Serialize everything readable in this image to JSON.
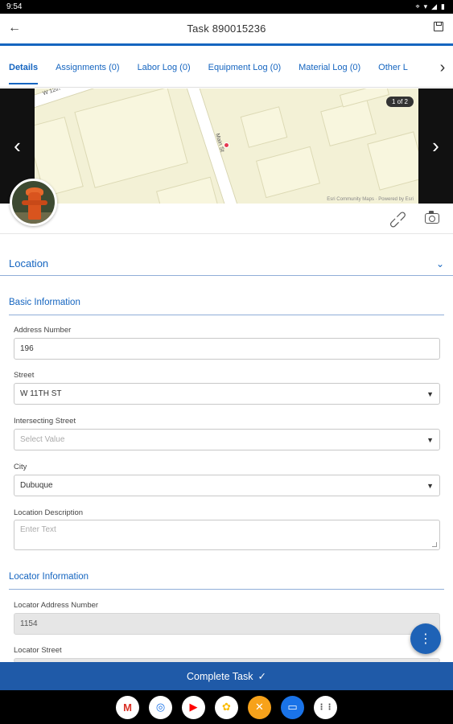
{
  "status_bar": {
    "time": "9:54",
    "icons": [
      "location-icon",
      "wifi-icon",
      "signal-icon",
      "battery-icon"
    ]
  },
  "app_bar": {
    "title": "Task 890015236"
  },
  "tabs": [
    {
      "label": "Details",
      "active": true
    },
    {
      "label": "Assignments (0)",
      "active": false
    },
    {
      "label": "Labor Log (0)",
      "active": false
    },
    {
      "label": "Equipment Log (0)",
      "active": false
    },
    {
      "label": "Material Log (0)",
      "active": false
    },
    {
      "label": "Other L",
      "active": false
    }
  ],
  "media": {
    "counter": "1 of 2",
    "map_credit": "Esri Community Maps  ·  Powered by Esri",
    "street_top": "W 12th",
    "street_main": "Main St"
  },
  "location_section": {
    "title": "Location"
  },
  "basic_info": {
    "title": "Basic Information",
    "address_number_label": "Address Number",
    "address_number_value": "196",
    "street_label": "Street",
    "street_value": "W 11TH ST",
    "intersecting_label": "Intersecting Street",
    "intersecting_placeholder": "Select Value",
    "city_label": "City",
    "city_value": "Dubuque",
    "location_desc_label": "Location Description",
    "location_desc_placeholder": "Enter Text"
  },
  "locator_info": {
    "title": "Locator Information",
    "address_number_label": "Locator Address Number",
    "address_number_value": "1154",
    "street_label": "Locator Street"
  },
  "fab": {
    "icon": "more-vert-icon"
  },
  "complete_button": {
    "label": "Complete Task",
    "icon": "✓"
  },
  "dock_apps": [
    {
      "name": "gmail",
      "glyph": "M",
      "color": "#d93025"
    },
    {
      "name": "chrome",
      "glyph": "◎",
      "color": "#1a73e8"
    },
    {
      "name": "youtube",
      "glyph": "▶",
      "color": "#ff0000"
    },
    {
      "name": "photos",
      "glyph": "✿",
      "color": "#fbbc04"
    },
    {
      "name": "tools",
      "glyph": "✕",
      "color": "#f29900"
    },
    {
      "name": "messages",
      "glyph": "▭",
      "color": "#1a73e8"
    },
    {
      "name": "app-drawer",
      "glyph": "⋮⋮",
      "color": "#444"
    }
  ]
}
